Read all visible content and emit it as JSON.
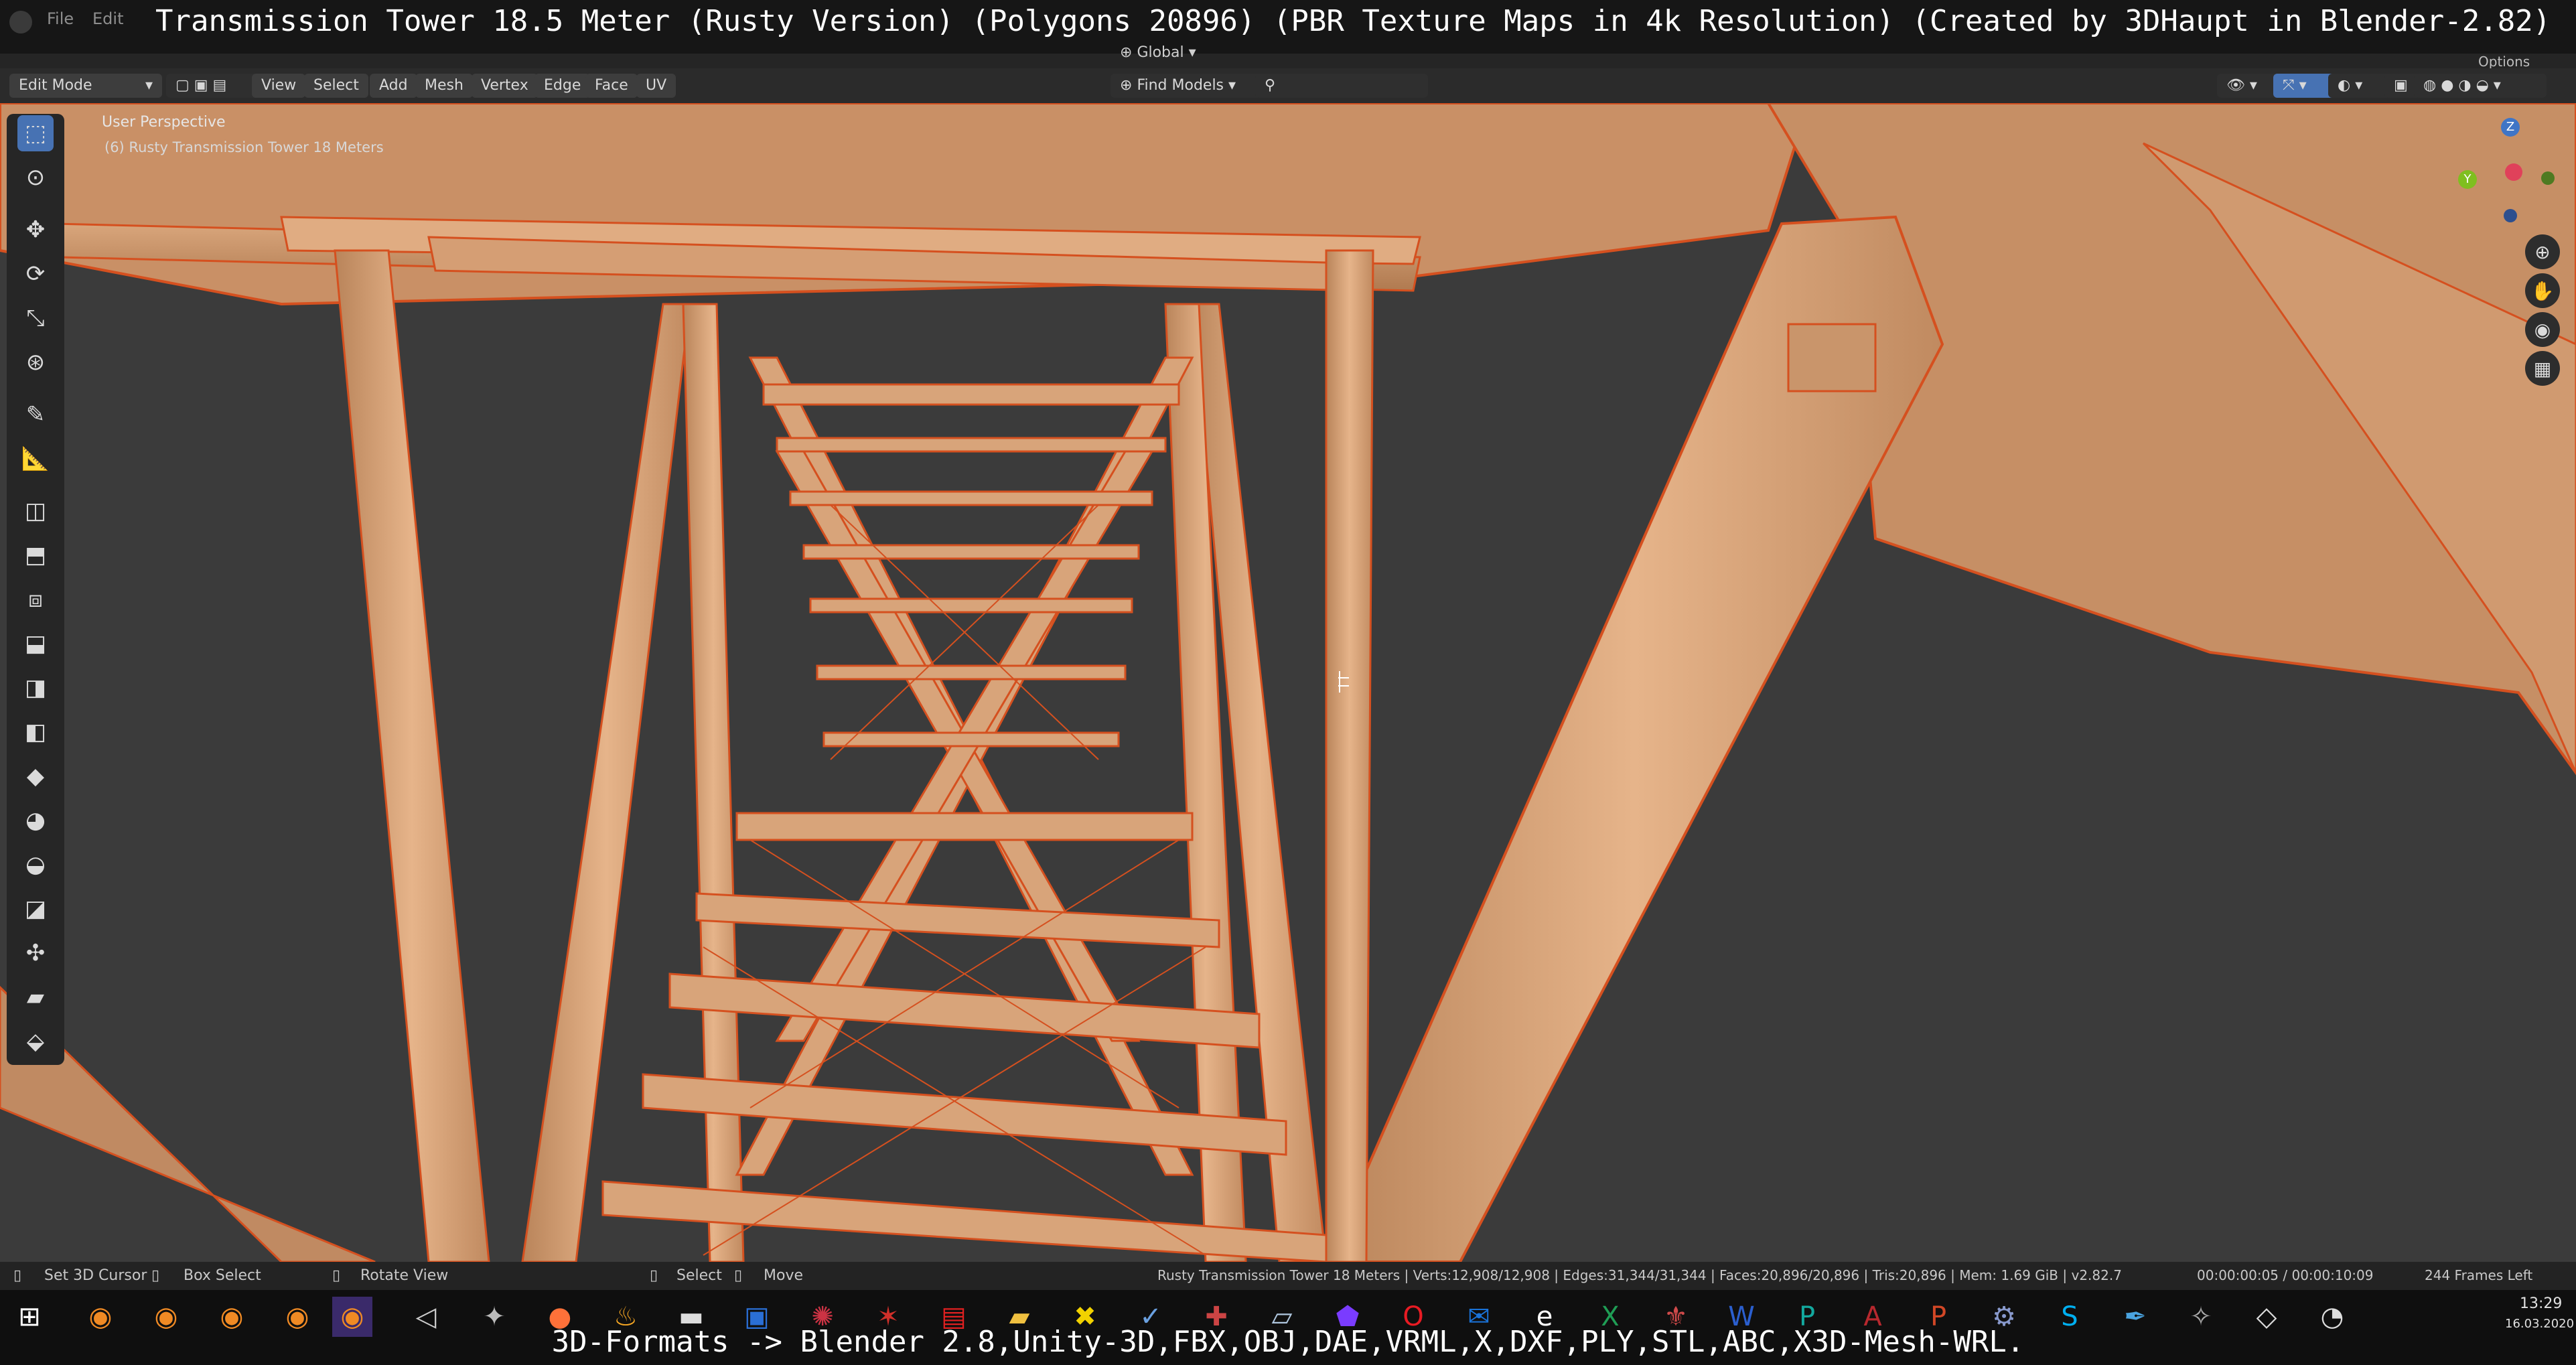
{
  "title_caption": "Transmission Tower 18.5 Meter (Rusty Version) (Polygons 20896) (PBR Texture Maps in 4k Resolution) (Created by 3DHaupt in Blender-2.82)",
  "top_menu": {
    "file": "File",
    "edit": "Edit",
    "options": "Options"
  },
  "header": {
    "mode": "Edit Mode",
    "menus": [
      "View",
      "Select",
      "Add",
      "Mesh",
      "Vertex",
      "Edge",
      "Face",
      "UV"
    ],
    "orientation": "Global",
    "find_models": "Find Models"
  },
  "viewport": {
    "view_name": "User Perspective",
    "object_name": "(6) Rusty Transmission Tower 18 Meters",
    "gizmo": {
      "z": "Z",
      "y": "Y"
    }
  },
  "status_bar": {
    "set_cursor": "Set 3D Cursor",
    "box_select": "Box Select",
    "rotate_view": "Rotate View",
    "select": "Select",
    "move": "Move",
    "stats": "Rusty Transmission Tower 18 Meters | Verts:12,908/12,908 | Edges:31,344/31,344 | Faces:20,896/20,896 | Tris:20,896 | Mem: 1.69 GiB | v2.82.7",
    "time": "00:00:00:05 / 00:00:10:09",
    "frames_left": "244 Frames Left"
  },
  "taskbar": {
    "time": "13:29",
    "date": "16.03.2020"
  },
  "bottom_caption": "3D-Formats -> Blender 2.8,Unity-3D,FBX,OBJ,DAE,VRML,X,DXF,PLY,STL,ABC,X3D-Mesh-WRL."
}
